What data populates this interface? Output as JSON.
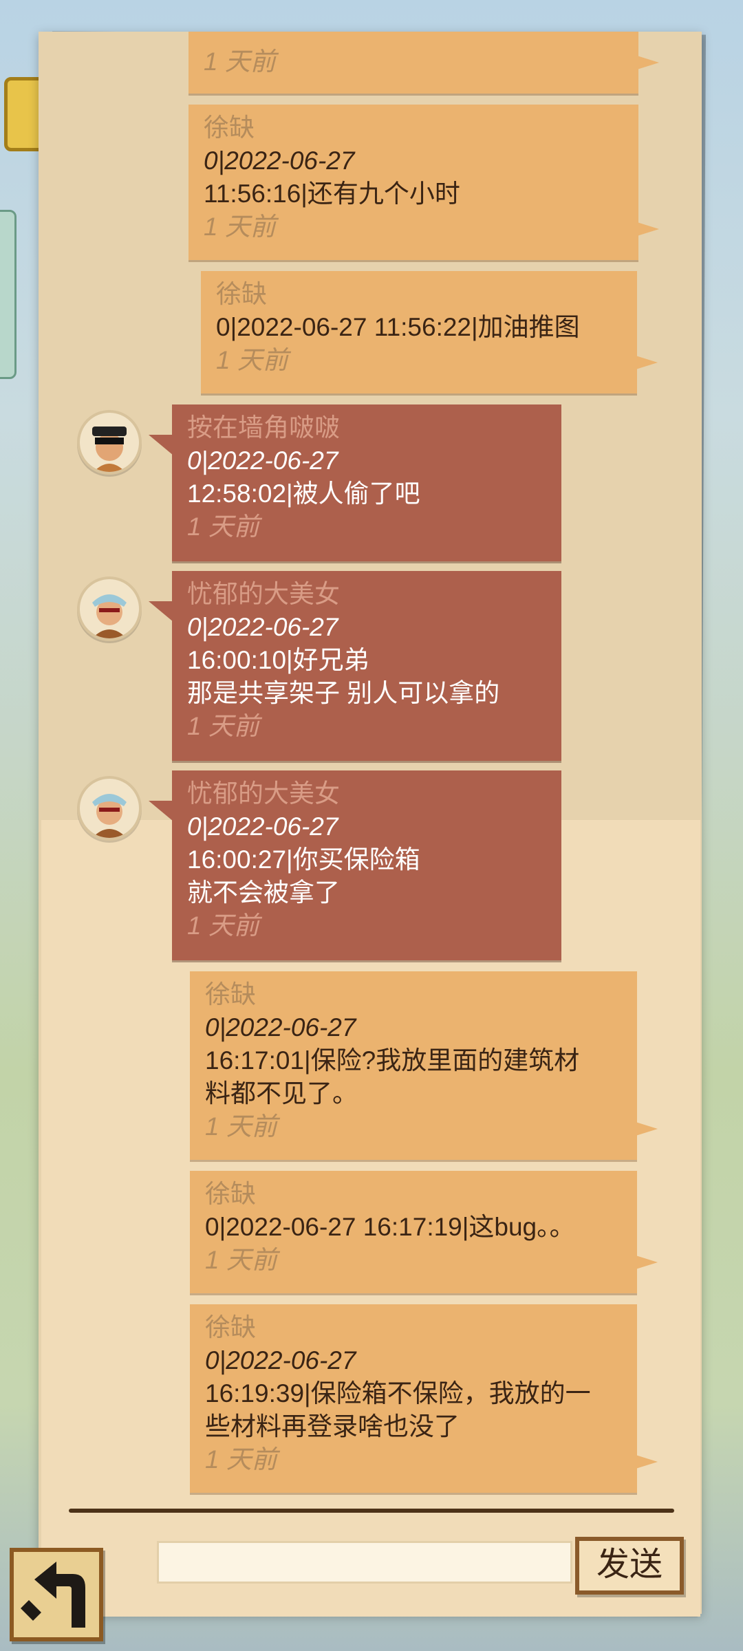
{
  "messages": [
    {
      "side": "mine",
      "sender": "",
      "lines": [],
      "time": "1 天前"
    },
    {
      "side": "mine",
      "sender": "徐缺",
      "lines": [
        "0|2022-06-27",
        "11:56:16|还有九个小时"
      ],
      "time": "1 天前"
    },
    {
      "side": "mine",
      "sender": "徐缺",
      "lines": [
        "0|2022-06-27 11:56:22|加油推图"
      ],
      "time": "1 天前"
    },
    {
      "side": "other",
      "sender": "按在墙角啵啵",
      "lines": [
        "0|2022-06-27",
        "12:58:02|被人偷了吧"
      ],
      "time": "1 天前"
    },
    {
      "side": "other",
      "sender": "忧郁的大美女",
      "lines": [
        "0|2022-06-27",
        "16:00:10|好兄弟",
        "那是共享架子 别人可以拿的"
      ],
      "time": "1 天前"
    },
    {
      "side": "other",
      "sender": "忧郁的大美女",
      "lines": [
        "0|2022-06-27",
        "16:00:27|你买保险箱",
        "就不会被拿了"
      ],
      "time": "1 天前"
    },
    {
      "side": "mine",
      "sender": "徐缺",
      "lines": [
        "0|2022-06-27",
        "16:17:01|保险?我放里面的建筑材",
        "料都不见了。"
      ],
      "time": "1 天前"
    },
    {
      "side": "mine",
      "sender": "徐缺",
      "lines": [
        "0|2022-06-27 16:17:19|这bug。。"
      ],
      "time": "1 天前"
    },
    {
      "side": "mine",
      "sender": "徐缺",
      "lines": [
        "0|2022-06-27",
        "16:19:39|保险箱不保险，我放的一",
        "些材料再登录啥也没了"
      ],
      "time": "1 天前"
    }
  ],
  "input": {
    "value": "",
    "placeholder": ""
  },
  "send_label": "发送",
  "icons": {
    "back": "back-arrow-icon",
    "avatar": "player-avatar-icon"
  }
}
